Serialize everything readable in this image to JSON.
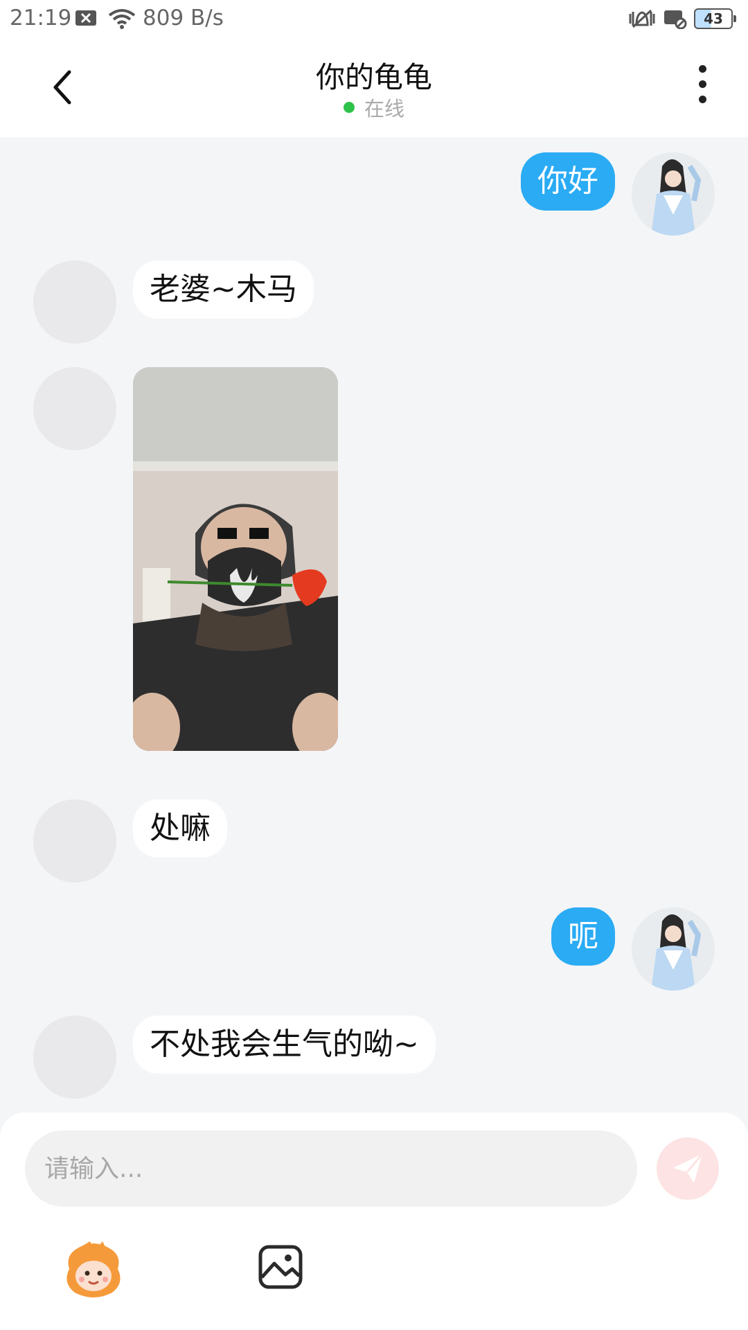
{
  "status_bar": {
    "time": "21:19",
    "network_speed": "809 B/s",
    "battery_level": "43",
    "icons": [
      "notification-x-icon",
      "wifi-icon",
      "vibrate-icon",
      "no-sim-icon",
      "battery-icon"
    ]
  },
  "header": {
    "title": "你的龟龟",
    "presence": "在线",
    "presence_color": "#2ec24a",
    "icons": [
      "back-arrow-icon",
      "more-vertical-icon"
    ]
  },
  "messages": [
    {
      "side": "out",
      "type": "text",
      "text": "你好"
    },
    {
      "side": "in",
      "type": "text",
      "text": "老婆~木马"
    },
    {
      "side": "in",
      "type": "image",
      "alt": "photo"
    },
    {
      "side": "in",
      "type": "text",
      "text": "处嘛"
    },
    {
      "side": "out",
      "type": "text",
      "text": "呃"
    },
    {
      "side": "in",
      "type": "text",
      "text": "不处我会生气的呦~"
    }
  ],
  "composer": {
    "placeholder": "请输入...",
    "value": "",
    "icons": [
      "send-icon",
      "sticker-icon",
      "image-icon"
    ]
  },
  "colors": {
    "accent": "#2aabf4",
    "background": "#f4f5f7",
    "send_disabled": "#fde3e3"
  }
}
